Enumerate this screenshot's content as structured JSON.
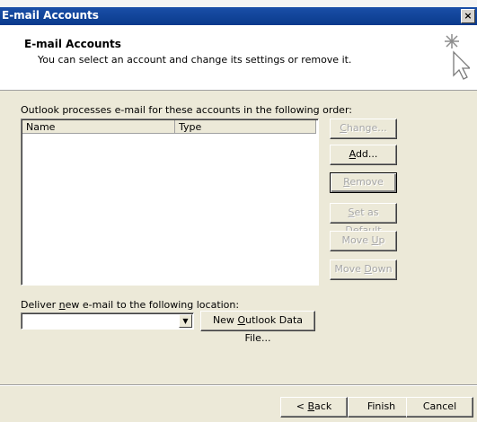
{
  "window": {
    "title": "E-mail Accounts",
    "close_glyph": "×"
  },
  "header": {
    "title": "E-mail Accounts",
    "subtitle": "You can select an account and change its settings or remove it.",
    "icon": "wizard-sparkle-icon"
  },
  "accounts": {
    "order_label": "Outlook processes e-mail for these accounts in the following order:",
    "columns": [
      "Name",
      "Type"
    ],
    "rows": []
  },
  "side_buttons": {
    "change": {
      "label": "Change...",
      "accel": "C",
      "disabled": true
    },
    "add": {
      "label": "Add...",
      "accel": "A",
      "disabled": false
    },
    "remove": {
      "label": "Remove",
      "accel": "R",
      "disabled": true
    },
    "set_default": {
      "label": "Set as Default",
      "accel": "S",
      "disabled": true
    },
    "move_up": {
      "label": "Move Up",
      "accel": "U",
      "disabled": true
    },
    "move_down": {
      "label": "Move Down",
      "accel": "D",
      "disabled": true
    }
  },
  "delivery": {
    "label": "Deliver new e-mail to the following location:",
    "location_value": "",
    "new_data_file_label": "New Outlook Data File..."
  },
  "footer": {
    "back_label": "< Back",
    "finish_label": "Finish",
    "cancel_label": "Cancel"
  }
}
